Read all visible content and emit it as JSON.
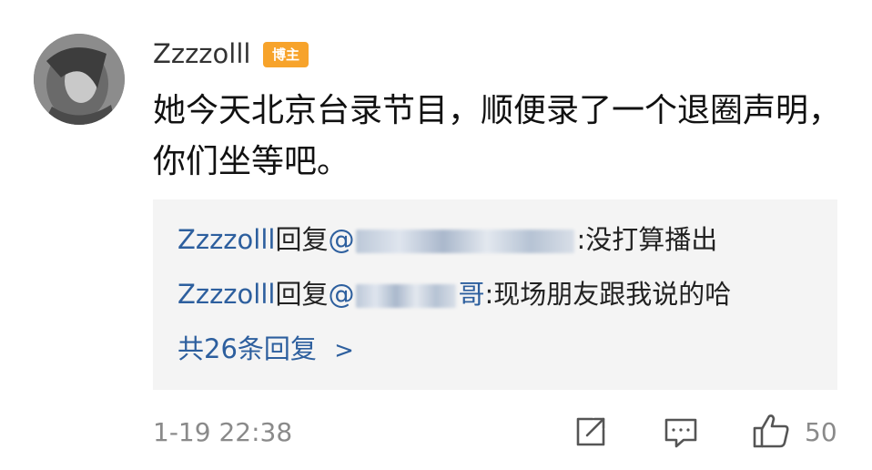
{
  "comment": {
    "username": "Zzzzolll",
    "badge": "博主",
    "content": "她今天北京台录节目，顺便录了一个退圈声明，你们坐等吧。",
    "timestamp": "1-19 22:38",
    "like_count": "50"
  },
  "replies": {
    "items": [
      {
        "author": "Zzzzolll",
        "verb": "回复",
        "at": "@",
        "mention_suffix": "",
        "text": ":没打算播出"
      },
      {
        "author": "Zzzzolll",
        "verb": "回复",
        "at": "@",
        "mention_suffix": "哥",
        "text": ":现场朋友跟我说的哈"
      }
    ],
    "more_label": "共26条回复",
    "more_chevron": ">"
  },
  "icons": [
    "avatar",
    "share-icon",
    "comment-icon",
    "like-icon"
  ]
}
